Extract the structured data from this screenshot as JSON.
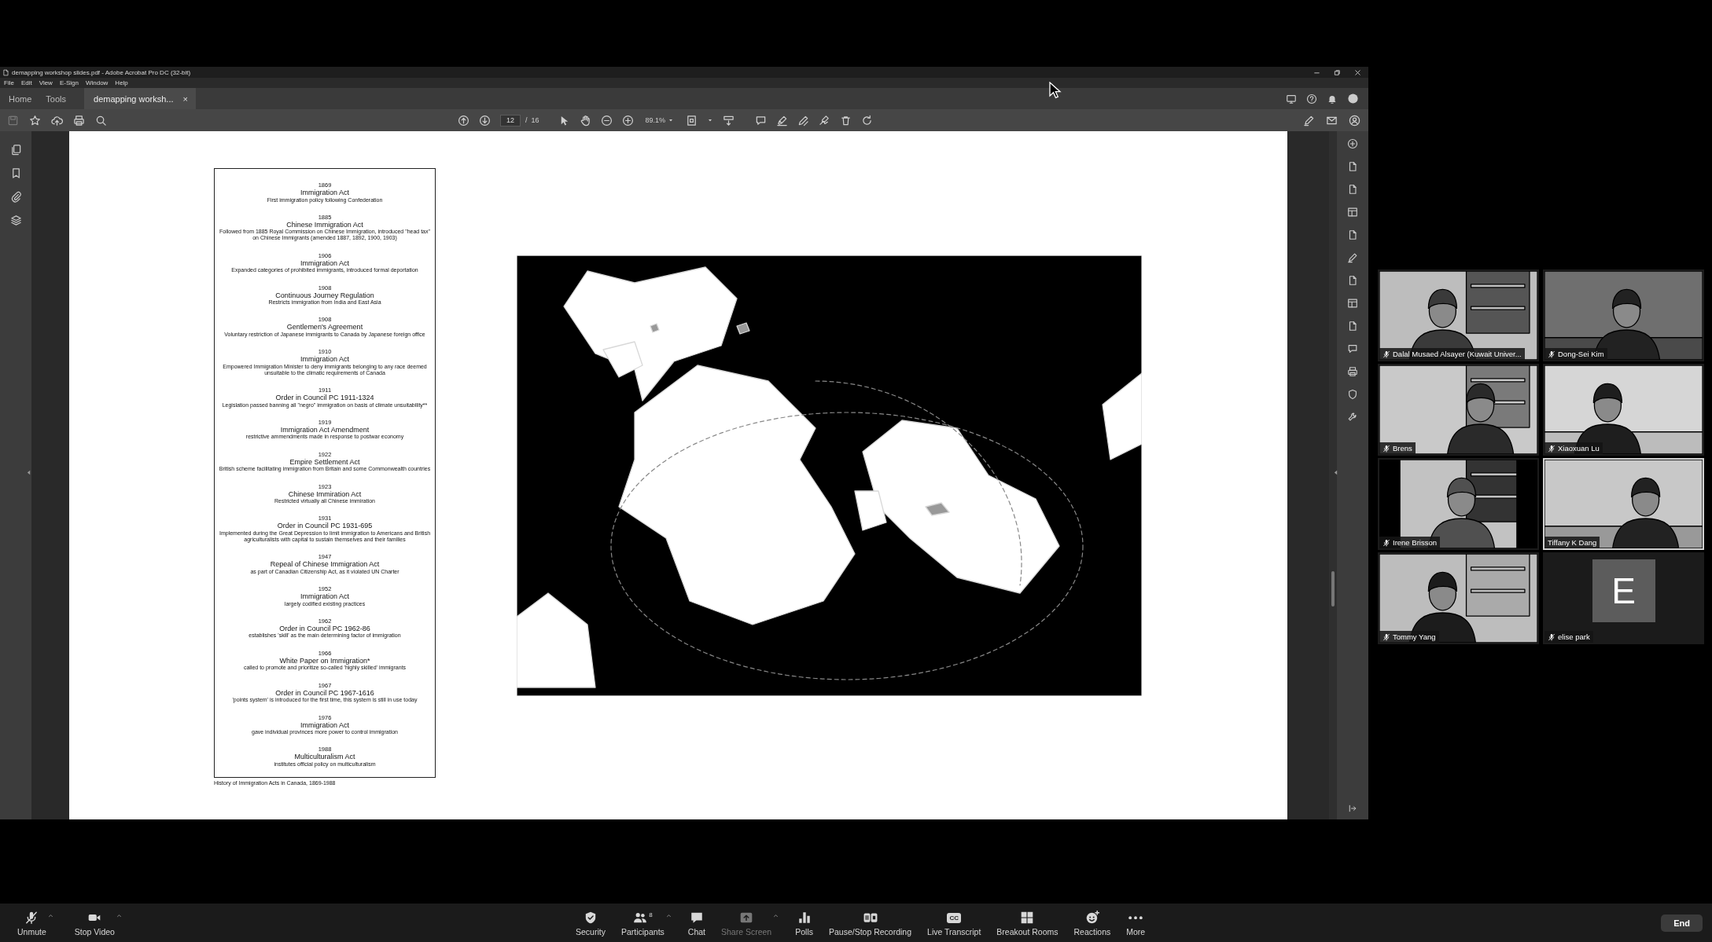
{
  "acrobat": {
    "title": "demapping workshop slides.pdf - Adobe Acrobat Pro DC (32-bit)",
    "menu": [
      "File",
      "Edit",
      "View",
      "E-Sign",
      "Window",
      "Help"
    ],
    "tabs": [
      {
        "label": "Home",
        "selected": false
      },
      {
        "label": "Tools",
        "selected": false
      },
      {
        "label": "demapping worksh...",
        "selected": true,
        "close": "×"
      }
    ],
    "toolbar": {
      "page_current": "12",
      "page_separator": "/",
      "page_total": "16",
      "zoom": "89.1%"
    },
    "document": {
      "timeline": [
        {
          "year": "1869",
          "title": "Immigration Act",
          "description": "First immigration policy following Confederation"
        },
        {
          "year": "1885",
          "title": "Chinese Immigration Act",
          "description": "Followed from 1885 Royal Commission on Chinese Immigration, introduced \"head tax\" on Chinese Immigrants (amended 1887, 1892, 1900, 1903)"
        },
        {
          "year": "1906",
          "title": "Immigration Act",
          "description": "Expanded categories of prohibited immigrants, introduced formal deportation"
        },
        {
          "year": "1908",
          "title": "Continuous Journey Regulation",
          "description": "Restricts immigration from India and East Asia"
        },
        {
          "year": "1908",
          "title": "Gentlemen's Agreement",
          "description": "Voluntary restriction of Japanese immigrants to Canada by Japanese foreign office"
        },
        {
          "year": "1910",
          "title": "Immigration Act",
          "description": "Empowered Immigration Minister to deny immigrants belonging to any race deemed unsuitable to the climatic requirements of Canada"
        },
        {
          "year": "1911",
          "title": "Order in Council PC 1911-1324",
          "description": "Legislation passed banning all \"negro\" immigration on basis of climate unsuitability**"
        },
        {
          "year": "1919",
          "title": "Immigration Act Amendment",
          "description": "restrictive ammendments made in response to postwar economy"
        },
        {
          "year": "1922",
          "title": "Empire Settlement Act",
          "description": "British scheme facilitating immigration from Britain and some Commonwealth countries"
        },
        {
          "year": "1923",
          "title": "Chinese Immiration Act",
          "description": "Restricted virtually all Chinese immiration"
        },
        {
          "year": "1931",
          "title": "Order in Council PC 1931-695",
          "description": "Implemented during the Great Depression to limit immigration to Americans and British agriculturalists with capital to sustain themselves and their families"
        },
        {
          "year": "1947",
          "title": "Repeal of Chinese Immigration Act",
          "description": "as part of Canadian Citizenship Act, as it violated UN Charter"
        },
        {
          "year": "1952",
          "title": "Immigration Act",
          "description": "largely codified existing practices"
        },
        {
          "year": "1962",
          "title": "Order in Council PC 1962-86",
          "description": "establishes 'skill' as the main determining factor of immigration"
        },
        {
          "year": "1966",
          "title": "White Paper on Immigration*",
          "description": "called to promote and prioritize so-called 'highly skilled' immigrants"
        },
        {
          "year": "1967",
          "title": "Order in Council PC 1967-1616",
          "description": "'points system' is introduced for the first time, this system is still in use today"
        },
        {
          "year": "1976",
          "title": "Immigration Act",
          "description": "gave individual provinces more power to control immigration"
        },
        {
          "year": "1988",
          "title": "Multiculturalism Act",
          "description": "institutes official policy on multiculturalism"
        }
      ],
      "caption": "History of Immigration Acts in Canada, 1869-1988"
    }
  },
  "meeting": {
    "participants": [
      {
        "name": "Dalal Musaed Alsayer (Kuwait Univer...",
        "kind": "video",
        "muted": true,
        "active_speaker": false
      },
      {
        "name": "Dong-Sei Kim",
        "kind": "video",
        "muted": true,
        "active_speaker": false
      },
      {
        "name": "Brens",
        "kind": "video",
        "muted": true,
        "active_speaker": false
      },
      {
        "name": "Xiaoxuan Lu",
        "kind": "video",
        "muted": true,
        "active_speaker": false
      },
      {
        "name": "Irene Brisson",
        "kind": "video",
        "muted": true,
        "active_speaker": false
      },
      {
        "name": "Tiffany K Dang",
        "kind": "video",
        "muted": false,
        "active_speaker": true
      },
      {
        "name": "Tommy Yang",
        "kind": "video",
        "muted": true,
        "active_speaker": false
      },
      {
        "name": "elise park",
        "kind": "avatar",
        "initial": "E",
        "muted": true,
        "active_speaker": false
      }
    ],
    "left_controls": [
      {
        "label": "Unmute",
        "has_menu": true,
        "disabled": false
      },
      {
        "label": "Stop Video",
        "has_menu": true,
        "disabled": false
      }
    ],
    "center_controls": [
      {
        "label": "Security",
        "has_menu": false,
        "disabled": false
      },
      {
        "label": "Participants",
        "count": "8",
        "has_menu": true,
        "disabled": false
      },
      {
        "label": "Chat",
        "has_menu": false,
        "disabled": false
      },
      {
        "label": "Share Screen",
        "has_menu": true,
        "disabled": true
      },
      {
        "label": "Polls",
        "has_menu": false,
        "disabled": false
      },
      {
        "label": "Pause/Stop Recording",
        "has_menu": false,
        "disabled": false
      },
      {
        "label": "Live Transcript",
        "badge": "CC",
        "has_menu": false,
        "disabled": false
      },
      {
        "label": "Breakout Rooms",
        "has_menu": false,
        "disabled": false
      },
      {
        "label": "Reactions",
        "has_menu": false,
        "disabled": false
      },
      {
        "label": "More",
        "has_menu": false,
        "disabled": false
      }
    ],
    "end_button": "End"
  }
}
